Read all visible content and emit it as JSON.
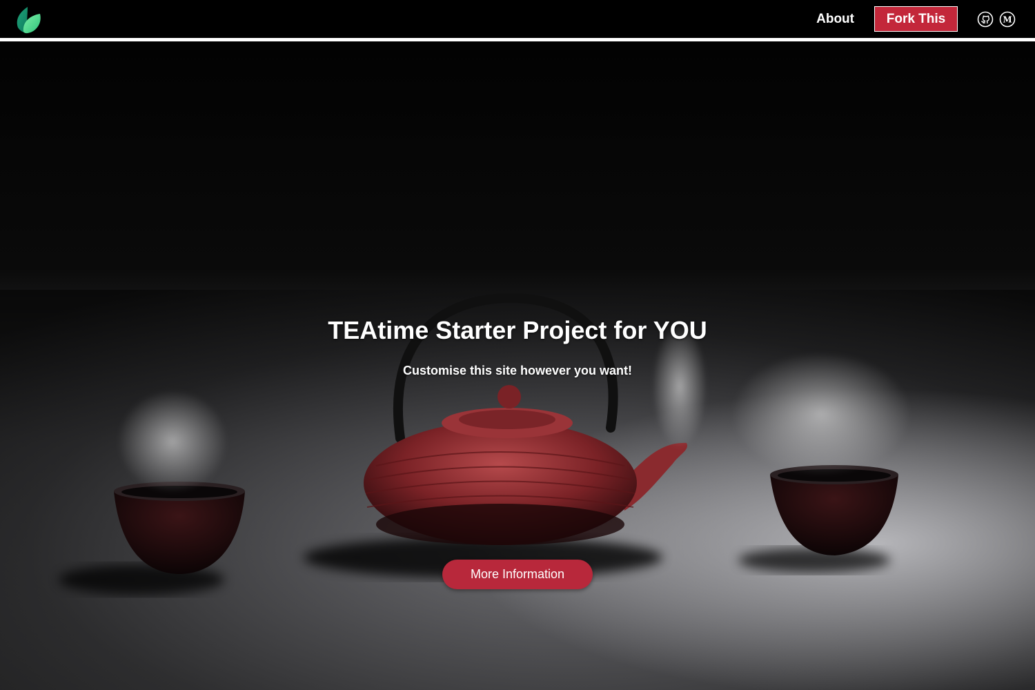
{
  "header": {
    "logo_icon": "leaf-icon",
    "nav": {
      "about_label": "About",
      "fork_label": "Fork This"
    },
    "social": [
      {
        "icon": "github-icon"
      },
      {
        "icon": "medium-icon"
      }
    ]
  },
  "hero": {
    "title": "TEAtime Starter Project for YOU",
    "subtitle": "Customise this site however you want!",
    "cta_label": "More Information",
    "background_image": "red cast-iron teapot with two steaming tea cups on a dark table"
  },
  "colors": {
    "accent": "#c3273a",
    "cta": "#b8283b",
    "navbar_bg": "#000000",
    "logo_green": "#3ecf7a"
  }
}
